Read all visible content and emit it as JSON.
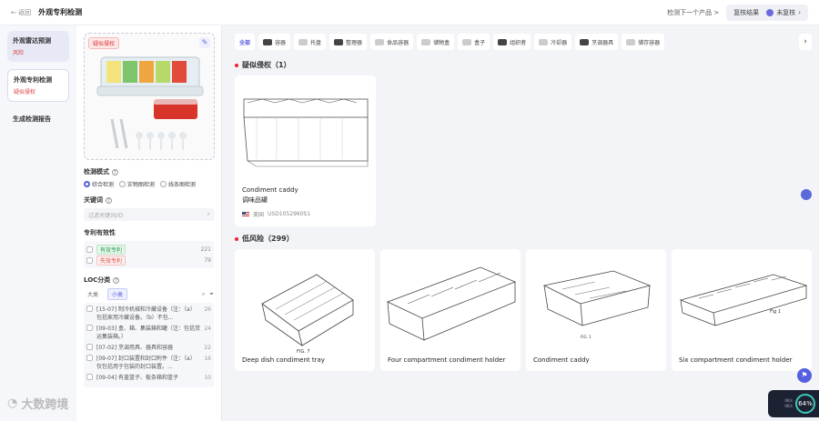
{
  "topbar": {
    "back": "← 返回",
    "title": "外观专利检测",
    "next_product": "检测下一个产品 >",
    "review_label": "复核结果",
    "status_label": "未复核"
  },
  "leftnav": {
    "items": [
      {
        "name": "外观雷达预测",
        "status": "风险"
      },
      {
        "name": "外观专利检测",
        "status": "疑似侵权"
      },
      {
        "name": "生成检测报告",
        "status": ""
      }
    ]
  },
  "panel": {
    "image_tag": "疑似侵权",
    "mode_title": "检测模式",
    "modes": [
      "综合检测",
      "实物图检测",
      "线条图检测"
    ],
    "keyword_title": "关键词",
    "keyword_placeholder": "过滤关键词/ID",
    "validity_title": "专利有效性",
    "validity": [
      {
        "label": "有效专利",
        "count": "221"
      },
      {
        "label": "失效专利",
        "count": "79"
      }
    ],
    "loc_title": "LOC分类",
    "loc_tabs": [
      "大类",
      "小类"
    ],
    "loc_items": [
      {
        "text": "[15-07] 制冷机械和冷藏设备（注：（a）包括家用冷藏设备。（b）不包...",
        "count": "26"
      },
      {
        "text": "[09-03] 盒、箱、集装箱和罐（注：包括货运集装箱。）",
        "count": "24"
      },
      {
        "text": "[07-02] 烹调用具、器具和容器",
        "count": "22"
      },
      {
        "text": "[09-07] 封口装置和封口附件（注：（a）仅包括用于包装的封口装置。...",
        "count": "16"
      },
      {
        "text": "[09-04] 有盖篮子、板条箱和篮子",
        "count": "10"
      }
    ]
  },
  "categories": [
    {
      "label": "全部",
      "icon": ""
    },
    {
      "label": "容器",
      "icon": "container-icon"
    },
    {
      "label": "托盘",
      "icon": "tray-icon"
    },
    {
      "label": "整理器",
      "icon": "organizer-icon"
    },
    {
      "label": "食品容器",
      "icon": "food-container-icon"
    },
    {
      "label": "储物盒",
      "icon": "storage-box-icon"
    },
    {
      "label": "盒子",
      "icon": "box-icon"
    },
    {
      "label": "组织者",
      "icon": "organizer2-icon"
    },
    {
      "label": "冷却器",
      "icon": "cooler-icon"
    },
    {
      "label": "烹调器具",
      "icon": "cookware-icon"
    },
    {
      "label": "储存容器",
      "icon": "storage-container-icon"
    }
  ],
  "groups": {
    "suspected": {
      "title": "疑似侵权（1）"
    },
    "low": {
      "title": "低风险（299）"
    }
  },
  "suspected_cards": [
    {
      "name": "Condiment caddy",
      "name_cn": "调味品罐",
      "region": "美国",
      "id": "USD1052960S1"
    }
  ],
  "low_cards": [
    {
      "name": "Deep dish condiment tray",
      "fig": "FIG. 7"
    },
    {
      "name": "Four compartment condiment holder",
      "fig": ""
    },
    {
      "name": "Condiment caddy",
      "fig": "FIG. 1"
    },
    {
      "name": "Six compartment condiment holder",
      "fig": "Fig 1"
    }
  ],
  "widget": {
    "percent": "64%",
    "line1": "0K/s",
    "line2": "0K/s"
  },
  "watermark": "大数跨境",
  "colors": {
    "accent": "#5560d8",
    "danger": "#dd3333",
    "bg": "#f3f4f7"
  }
}
